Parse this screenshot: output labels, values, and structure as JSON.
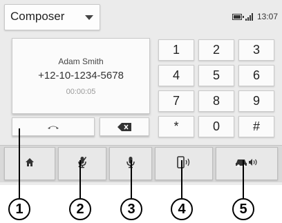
{
  "header": {
    "mode_label": "Composer",
    "clock": "13:07"
  },
  "contact": {
    "name": "Adam Smith",
    "number": "+12-10-1234-5678",
    "timer": "00:00:05"
  },
  "keypad": {
    "keys": [
      "1",
      "2",
      "3",
      "4",
      "5",
      "6",
      "7",
      "8",
      "9",
      "*",
      "0",
      "#"
    ]
  },
  "toolbar": {
    "items": [
      "home-icon",
      "microphone-muted-icon",
      "microphone-icon",
      "phone-handset-icon",
      "car-speaker-icon"
    ]
  },
  "callouts": [
    "1",
    "2",
    "3",
    "4",
    "5"
  ]
}
